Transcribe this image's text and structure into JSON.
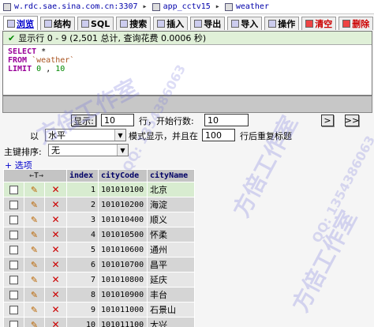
{
  "breadcrumb": {
    "server": "w.rdc.sae.sina.com.cn:3307",
    "database": "app_cctv15",
    "table": "weather"
  },
  "tabs": [
    {
      "label": "浏览",
      "active": true
    },
    {
      "label": "结构"
    },
    {
      "label": "SQL"
    },
    {
      "label": "搜索"
    },
    {
      "label": "插入"
    },
    {
      "label": "导出"
    },
    {
      "label": "导入"
    },
    {
      "label": "操作"
    },
    {
      "label": "清空",
      "danger": true
    },
    {
      "label": "删除",
      "danger": true
    }
  ],
  "notice": "显示行 0 - 9 (2,501 总计, 查询花费 0.0006 秒)",
  "sql": {
    "kw1": "SELECT",
    "star": "*",
    "kw2": "FROM",
    "table": "`weather`",
    "kw3": "LIMIT",
    "l0": "0",
    "comma": ",",
    "l1": "10"
  },
  "nav": {
    "show_button": "显示:",
    "rows": "10",
    "start_label": "行，开始行数:",
    "start": "10",
    "mode_prefix": "以",
    "mode": "水平",
    "mode_label": "模式显示，并且在",
    "repeat": "100",
    "repeat_label": "行后重复标题",
    "next_label": ">",
    "last_label": ">>"
  },
  "sort": {
    "label": "主键排序:",
    "value": "无"
  },
  "options_label": "+ 选项",
  "columns": [
    "index",
    "cityCode",
    "cityName"
  ],
  "header_sort": "←T→",
  "rows": [
    {
      "index": "1",
      "code": "101010100",
      "name": "北京"
    },
    {
      "index": "2",
      "code": "101010200",
      "name": "海淀"
    },
    {
      "index": "3",
      "code": "101010400",
      "name": "顺义"
    },
    {
      "index": "4",
      "code": "101010500",
      "name": "怀柔"
    },
    {
      "index": "5",
      "code": "101010600",
      "name": "通州"
    },
    {
      "index": "6",
      "code": "101010700",
      "name": "昌平"
    },
    {
      "index": "7",
      "code": "101010800",
      "name": "延庆"
    },
    {
      "index": "8",
      "code": "101010900",
      "name": "丰台"
    },
    {
      "index": "9",
      "code": "101011000",
      "name": "石景山"
    },
    {
      "index": "10",
      "code": "101011100",
      "name": "大兴"
    }
  ],
  "watermark": {
    "text": "方倍工作室",
    "qq": "QQ: 1354386063"
  }
}
